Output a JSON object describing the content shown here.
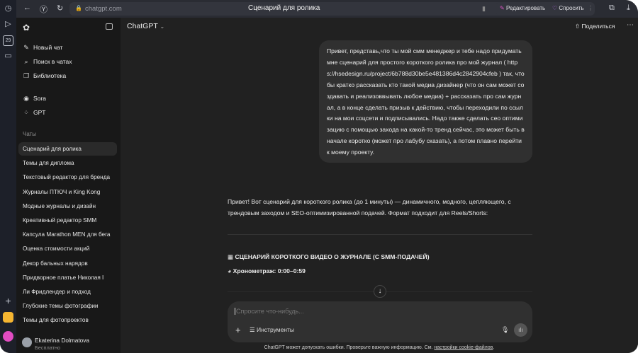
{
  "browser": {
    "url": "chatgpt.com",
    "tab_title": "Сценарий для ролика",
    "edit_label": "Редактировать",
    "ask_label": "Спросить",
    "calendar_day": "29"
  },
  "sidebar": {
    "top_items": [
      {
        "label": "Новый чат",
        "icon": "edit-icon"
      },
      {
        "label": "Поиск в чатах",
        "icon": "search-icon"
      },
      {
        "label": "Библиотека",
        "icon": "library-icon"
      }
    ],
    "apps": [
      {
        "label": "Sora",
        "icon": "play-circle-icon"
      },
      {
        "label": "GPT",
        "icon": "grid-icon"
      }
    ],
    "chats_heading": "Чаты",
    "chats": [
      "Сценарий для ролика",
      "Темы для диплома",
      "Текстовый редактор для бренда",
      "Журналы ПТЮЧ и King Kong",
      "Модные журналы и дизайн",
      "Креативный редактор SMM",
      "Капсула Marathon MEN для бега",
      "Оценка стоимости акций",
      "Декор бальных нарядов",
      "Придворное платье Николая I",
      "Ли Фридлендер и подход",
      "Глубокие темы фотографии",
      "Темы для фотопроектов"
    ],
    "user": {
      "name": "Ekaterina Dolmatova",
      "plan": "Бесплатно"
    }
  },
  "header": {
    "model": "ChatGPT",
    "share_label": "Поделиться"
  },
  "messages": {
    "user": "Привет, представь,что ты мой смм менеджер и тебе надо придумать мне сценарий для простого короткого ролика про мой журнал ( https://hsedesign.ru/project/6b788d30be5e481386d4c2842904cfeb ) так, чтобы кратко рассказать кто такой медиа дизайнер (что он сам может создавать и реализоввывать любое медиа) + рассказать про сам журнал, а в конце сделать призыв к действию, чтобы переходили по ссылки на мои соцсети и подписывались. Надо также сделать сео оптимизацию с помощью захода на какой-то тренд сейчас, это может быть в начале коротко (может про лабубу сказать), а потом плавно перейти к моему проекту.",
    "assistant_intro": "Привет! Вот сценарий для короткого ролика (до 1 минуты) — динамичного, модного, цепляющего, с трендовым заходом и SEO-оптимизированной подачей. Формат подходит для Reels/Shorts:",
    "heading": "СЦЕНАРИЙ КОРОТКОГО ВИДЕО О ЖУРНАЛЕ (С SMM-ПОДАЧЕЙ)",
    "duration": "Хронометраж: 0:00–0:59"
  },
  "composer": {
    "placeholder": "Спросите что-нибудь...",
    "tools_label": "Инструменты"
  },
  "footer": {
    "text": "ChatGPT может допускать ошибки. Проверьте важную информацию. См. ",
    "link": "настройки cookie-файлов",
    "end": "."
  }
}
